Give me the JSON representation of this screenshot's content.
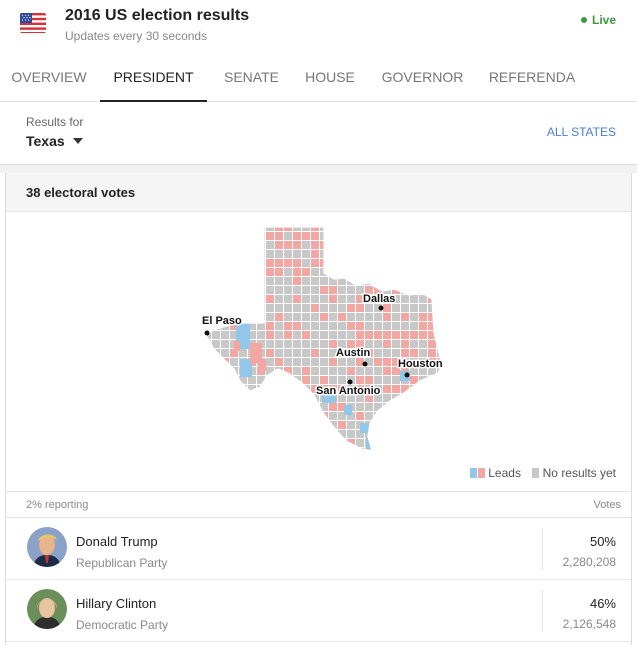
{
  "header": {
    "title": "2016 US election results",
    "subtitle": "Updates every 30 seconds",
    "live_label": "Live",
    "flag_icon": "us-flag-icon"
  },
  "tabs": [
    {
      "label": "OVERVIEW",
      "active": false
    },
    {
      "label": "PRESIDENT",
      "active": true
    },
    {
      "label": "SENATE",
      "active": false
    },
    {
      "label": "HOUSE",
      "active": false
    },
    {
      "label": "GOVERNOR",
      "active": false
    },
    {
      "label": "REFERENDA",
      "active": false
    }
  ],
  "results_for": {
    "label": "Results for",
    "selected": "Texas",
    "all_states_link": "ALL STATES"
  },
  "card": {
    "electoral_votes": "38 electoral votes",
    "map": {
      "cities": [
        "Dallas",
        "El Paso",
        "Austin",
        "Houston",
        "San Antonio"
      ]
    },
    "legend": {
      "leads": "Leads",
      "no_results": "No results yet"
    },
    "reporting": "2% reporting",
    "votes_header": "Votes",
    "candidates": [
      {
        "name": "Donald Trump",
        "party": "Republican Party",
        "percent": "50%",
        "votes": "2,280,208"
      },
      {
        "name": "Hillary Clinton",
        "party": "Democratic Party",
        "percent": "46%",
        "votes": "2,126,548"
      }
    ]
  },
  "colors": {
    "republican": "#f2a7a3",
    "democrat": "#93c7ea",
    "no_results": "#c8c8c8",
    "live": "#3c9b3c",
    "link": "#4a7fd4"
  }
}
